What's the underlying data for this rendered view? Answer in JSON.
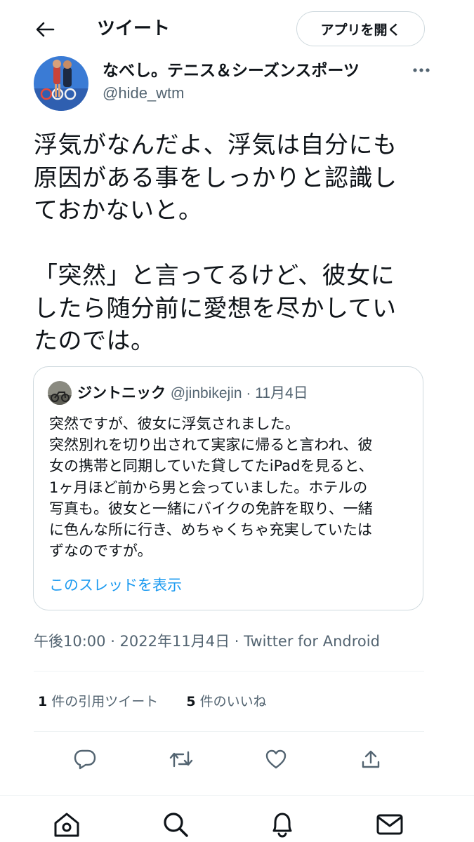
{
  "header": {
    "back_icon": "arrow-left-icon",
    "title": "ツイート",
    "open_app_label": "アプリを開く"
  },
  "tweet": {
    "author_name": "なべし。テニス＆シーズンスポーツ",
    "author_handle": "@hide_wtm",
    "more_icon": "more-horizontal-icon",
    "text_lines": [
      "浮気がなんだよ、浮気は自分にも",
      "原因がある事をしっかりと認識し",
      "ておかないと。",
      "",
      "「突然」と言ってるけど、彼女に",
      "したら随分前に愛想を尽かしてい",
      "たのでは。"
    ],
    "timestamp": "午後10:00 · 2022年11月4日 · Twitter for Android"
  },
  "quoted_tweet": {
    "author_name": "ジントニック",
    "author_meta": "@jinbikejin · 11月4日",
    "text_lines": [
      "突然ですが、彼女に浮気されました。",
      "突然別れを切り出されて実家に帰ると言われ、彼",
      "女の携帯と同期していた貸してたiPadを見ると、",
      "1ヶ月ほど前から男と会っていました。ホテルの",
      "写真も。彼女と一緒にバイクの免許を取り、一緒",
      "に色んな所に行き、めちゃくちゃ充実していたは",
      "ずなのですが。"
    ],
    "show_thread_label": "このスレッドを表示"
  },
  "stats": {
    "quote_count": "1",
    "quote_label": "件の引用ツイート",
    "like_count": "5",
    "like_label": "件のいいね"
  },
  "actions": {
    "reply_icon": "reply-icon",
    "retweet_icon": "retweet-icon",
    "like_icon": "heart-icon",
    "share_icon": "share-icon"
  },
  "bottom_nav": {
    "home_icon": "home-icon",
    "search_icon": "search-icon",
    "notifications_icon": "bell-icon",
    "messages_icon": "mail-icon"
  },
  "colors": {
    "link": "#1d9bf0",
    "secondary_text": "#536471",
    "border": "#cfd9de"
  }
}
